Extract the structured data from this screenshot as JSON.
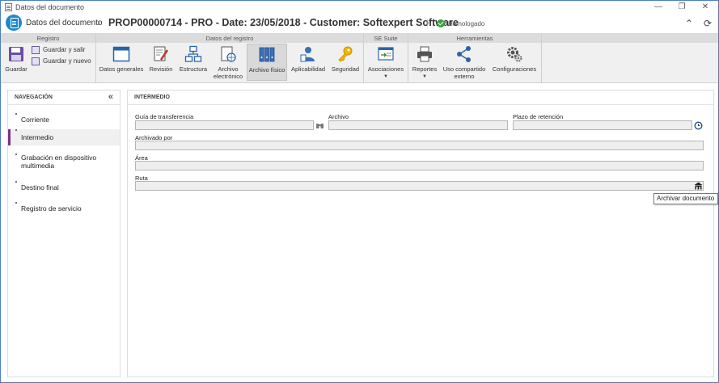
{
  "window": {
    "title": "Datos del documento"
  },
  "header": {
    "breadcrumb": "Datos del documento",
    "doc_title": "PROP00000714 - PRO - Date: 23/05/2018 - Customer: Softexpert Software",
    "status": "Homologado"
  },
  "ribbon": {
    "groups": {
      "registro": "Registro",
      "datos": "Datos del registro",
      "suite": "SE Suite",
      "herramientas": "Herramientas"
    },
    "guardar": "Guardar",
    "guardar_salir": "Guardar y salir",
    "guardar_nuevo": "Guardar y nuevo",
    "datos_generales": "Datos generales",
    "revision": "Revisión",
    "estructura": "Estructura",
    "archivo_electronico_1": "Archivo",
    "archivo_electronico_2": "electrónico",
    "archivo_fisico": "Archivo físico",
    "aplicabilidad": "Aplicabilidad",
    "seguridad": "Seguridad",
    "asociaciones": "Asociaciones",
    "reportes": "Reportes",
    "uso_compartido_1": "Uso compartido",
    "uso_compartido_2": "externo",
    "configuraciones": "Configuraciones"
  },
  "nav": {
    "title": "NAVEGACIÓN",
    "items": [
      {
        "label": "Corriente"
      },
      {
        "label": "Intermedio"
      },
      {
        "label": "Grabación en dispositivo multimedia"
      },
      {
        "label": "Destino final"
      },
      {
        "label": "Registro de servicio"
      }
    ],
    "selected_index": 1
  },
  "main": {
    "section_title": "INTERMEDIO",
    "fields": {
      "guia_label": "Guía de transferencia",
      "guia_value": "",
      "archivo_label": "Archivo",
      "archivo_value": "",
      "plazo_label": "Plazo de retención",
      "plazo_value": "",
      "archivado_label": "Archivado por",
      "archivado_value": "",
      "area_label": "Área",
      "area_value": "",
      "ruta_label": "Ruta",
      "ruta_value": ""
    },
    "tooltip": "Archivar documento"
  },
  "colors": {
    "accent": "#1e88c8",
    "nav_selected": "#7b2f8e",
    "status_ok": "#3aa43a"
  }
}
